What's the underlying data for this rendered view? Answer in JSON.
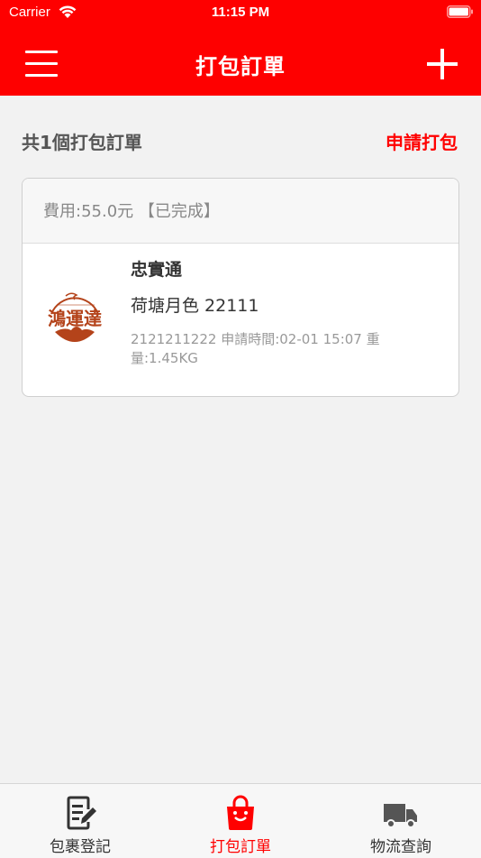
{
  "status_bar": {
    "carrier": "Carrier",
    "time": "11:15 PM"
  },
  "nav": {
    "title": "打包訂單",
    "menu_icon": "hamburger-menu-icon",
    "add_icon": "plus-icon"
  },
  "summary": {
    "count_text": "共1個打包訂單",
    "apply_label": "申請打包"
  },
  "orders": [
    {
      "status_line": "費用:55.0元 【已完成】",
      "logo_text": "鴻運達",
      "recipient": "忠實通",
      "item": "荷塘月色 22111",
      "meta": "2121211222 申請時間:02-01 15:07 重量:1.45KG"
    }
  ],
  "tabbar": {
    "items": [
      {
        "label": "包裹登記",
        "icon": "form-edit-icon"
      },
      {
        "label": "打包訂單",
        "icon": "shopping-bag-icon"
      },
      {
        "label": "物流查詢",
        "icon": "truck-icon"
      }
    ]
  },
  "colors": {
    "accent": "#fe0000",
    "background": "#f2f2f2",
    "logo_brown": "#b4431a"
  }
}
